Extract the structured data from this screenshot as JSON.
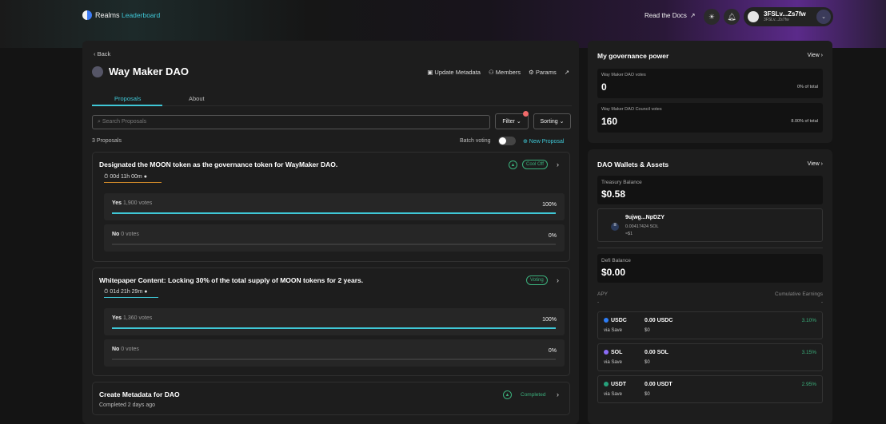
{
  "header": {
    "app_name": "Realms",
    "leaderboard": "Leaderboard",
    "docs": "Read the Docs",
    "user_name": "3FSLv...Zs7fw",
    "user_sub": "3FSLv...Zs7fw"
  },
  "main": {
    "back": "‹ Back",
    "dao_name": "Way Maker DAO",
    "actions": {
      "update": "Update Metadata",
      "members": "Members",
      "params": "Params"
    },
    "tabs": [
      "Proposals",
      "About"
    ],
    "search_placeholder": "Search Proposals",
    "filter": "Filter ⌄",
    "sorting": "Sorting ⌄",
    "count": "3 Proposals",
    "batch": "Batch voting",
    "new_proposal": "⊕ New Proposal"
  },
  "proposals": [
    {
      "title": "Designated the MOON token as the governance token for WayMaker DAO.",
      "timer": "00d 11h 00m",
      "status": "Cool Off",
      "yes": {
        "label": "Yes",
        "votes": "1,900 votes",
        "pct": "100%",
        "fill": 1
      },
      "no": {
        "label": "No",
        "votes": "0 votes",
        "pct": "0%",
        "fill": 0
      }
    },
    {
      "title": "Whitepaper Content: Locking 30% of the total supply of MOON tokens for 2 years.",
      "timer": "01d 21h 29m",
      "status": "Voting",
      "yes": {
        "label": "Yes",
        "votes": "1,360 votes",
        "pct": "100%",
        "fill": 1
      },
      "no": {
        "label": "No",
        "votes": "0 votes",
        "pct": "0%",
        "fill": 0
      }
    },
    {
      "title": "Create Metadata for DAO",
      "sub": "Completed 2 days ago",
      "status": "Completed"
    }
  ],
  "governance": {
    "title": "My governance power",
    "view": "View ›",
    "dao_votes_label": "Way Maker DAO votes",
    "dao_votes": "0",
    "dao_votes_pct": "0% of total",
    "council_label": "Way Maker DAO Council votes",
    "council_votes": "160",
    "council_pct": "8.00% of total"
  },
  "wallets": {
    "title": "DAO Wallets & Assets",
    "view": "View ›",
    "treasury_label": "Treasury Balance",
    "treasury": "$0.58",
    "wallet_name": "9ujwg...NpDZY",
    "wallet_sol": "0.00417424 SOL",
    "wallet_usd": "≈$1",
    "defi_label": "Defi Balance",
    "defi": "$0.00",
    "apy_label": "APY",
    "cumulative_label": "Cumulative Earnings",
    "dash1": "-",
    "dash2": "-",
    "assets": [
      {
        "sym": "USDC",
        "via": "via Save",
        "amt": "0.00 USDC",
        "usd": "$0",
        "apy": "3.10%",
        "color": "#2d7df6"
      },
      {
        "sym": "SOL",
        "via": "via Save",
        "amt": "0.00 SOL",
        "usd": "$0",
        "apy": "3.15%",
        "color": "#8b6cf6"
      },
      {
        "sym": "USDT",
        "via": "via Save",
        "amt": "0.00 USDT",
        "usd": "$0",
        "apy": "2.95%",
        "color": "#26a17b"
      }
    ]
  }
}
